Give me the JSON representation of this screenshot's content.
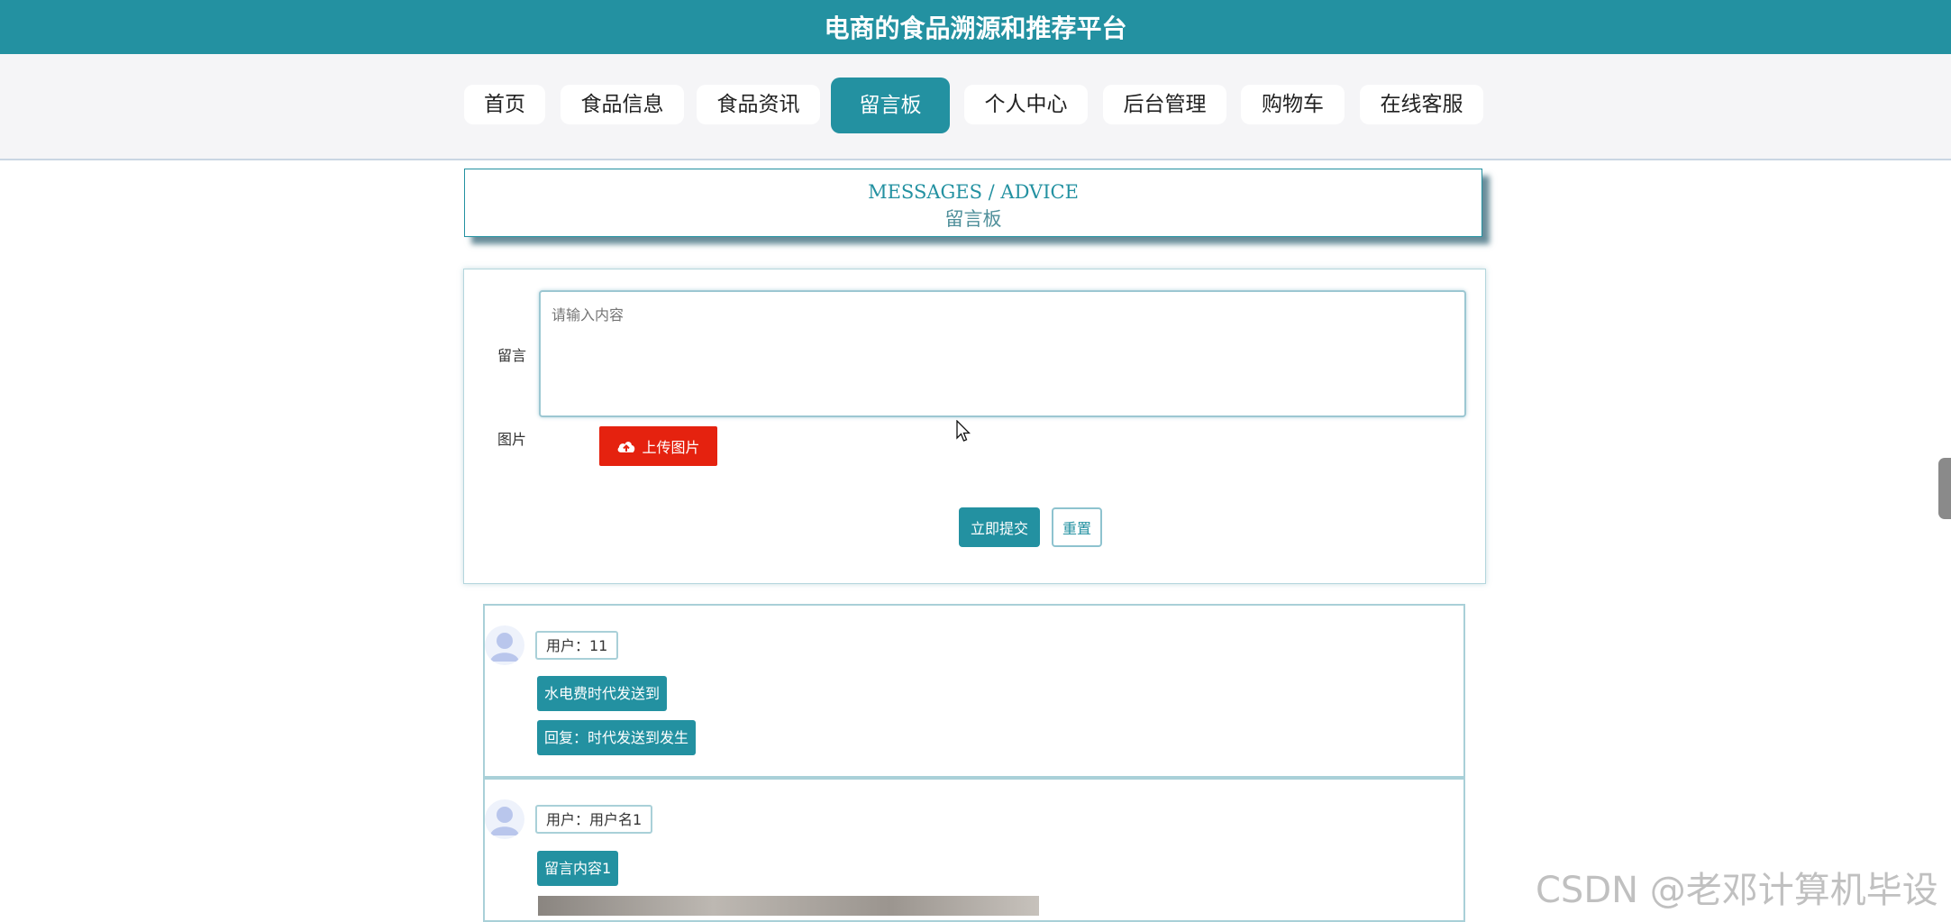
{
  "header": {
    "title": "电商的食品溯源和推荐平台"
  },
  "nav": {
    "items": [
      {
        "label": "首页",
        "active": false
      },
      {
        "label": "食品信息",
        "active": false
      },
      {
        "label": "食品资讯",
        "active": false
      },
      {
        "label": "留言板",
        "active": true
      },
      {
        "label": "个人中心",
        "active": false
      },
      {
        "label": "后台管理",
        "active": false
      },
      {
        "label": "购物车",
        "active": false
      },
      {
        "label": "在线客服",
        "active": false
      }
    ]
  },
  "section": {
    "title_en": "MESSAGES / ADVICE",
    "title_cn": "留言板"
  },
  "form": {
    "message_label": "留言",
    "message_placeholder": "请输入内容",
    "image_label": "图片",
    "upload_label": "上传图片",
    "submit_label": "立即提交",
    "reset_label": "重置"
  },
  "messages": [
    {
      "user": "用户：11",
      "content": "水电费时代发送到",
      "reply": "回复：时代发送到发生"
    },
    {
      "user": "用户：用户名1",
      "content": "留言内容1"
    }
  ],
  "watermark": "CSDN @老邓计算机毕设",
  "colors": {
    "primary": "#2391a1",
    "upload": "#e5220f"
  }
}
